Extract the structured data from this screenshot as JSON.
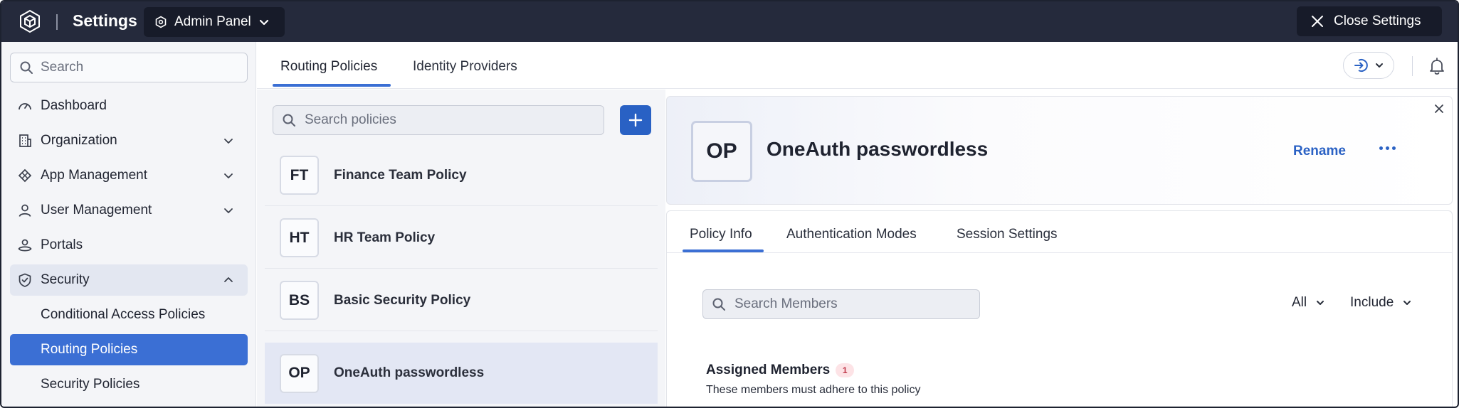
{
  "topbar": {
    "title": "Settings",
    "panel_switch": "Admin Panel",
    "close_label": "Close Settings"
  },
  "sidebar": {
    "search_placeholder": "Search",
    "items": [
      {
        "label": "Dashboard",
        "icon": "dashboard-gauge-icon"
      },
      {
        "label": "Organization",
        "icon": "building-icon",
        "expandable": true
      },
      {
        "label": "App Management",
        "icon": "apps-icon",
        "expandable": true
      },
      {
        "label": "User Management",
        "icon": "user-icon",
        "expandable": true
      },
      {
        "label": "Portals",
        "icon": "portal-icon"
      },
      {
        "label": "Security",
        "icon": "shield-icon",
        "expandable": true,
        "expanded": true
      }
    ],
    "security_sub_items": [
      {
        "label": "Conditional Access Policies"
      },
      {
        "label": "Routing Policies",
        "active": true
      },
      {
        "label": "Security Policies"
      }
    ]
  },
  "main_tabs": [
    {
      "label": "Routing Policies",
      "active": true
    },
    {
      "label": "Identity Providers"
    }
  ],
  "policies": {
    "search_placeholder": "Search policies",
    "items": [
      {
        "initials": "FT",
        "name": "Finance Team Policy"
      },
      {
        "initials": "HT",
        "name": "HR Team Policy"
      },
      {
        "initials": "BS",
        "name": "Basic Security Policy"
      },
      {
        "initials": "OP",
        "name": "OneAuth passwordless",
        "active": true
      }
    ]
  },
  "detail": {
    "initials": "OP",
    "title": "OneAuth passwordless",
    "rename_label": "Rename",
    "tabs": [
      {
        "label": "Policy Info",
        "active": true
      },
      {
        "label": "Authentication Modes"
      },
      {
        "label": "Session Settings"
      }
    ],
    "member_search_placeholder": "Search Members",
    "filter_scope": "All",
    "filter_mode": "Include",
    "assigned_title": "Assigned Members",
    "assigned_count": "1",
    "assigned_desc": "These members must adhere to this policy"
  },
  "colors": {
    "topbar_bg": "#252a3c",
    "accent": "#3b6fd4",
    "primary_button": "#2961c4",
    "sidebar_bg": "#f4f5f8"
  }
}
